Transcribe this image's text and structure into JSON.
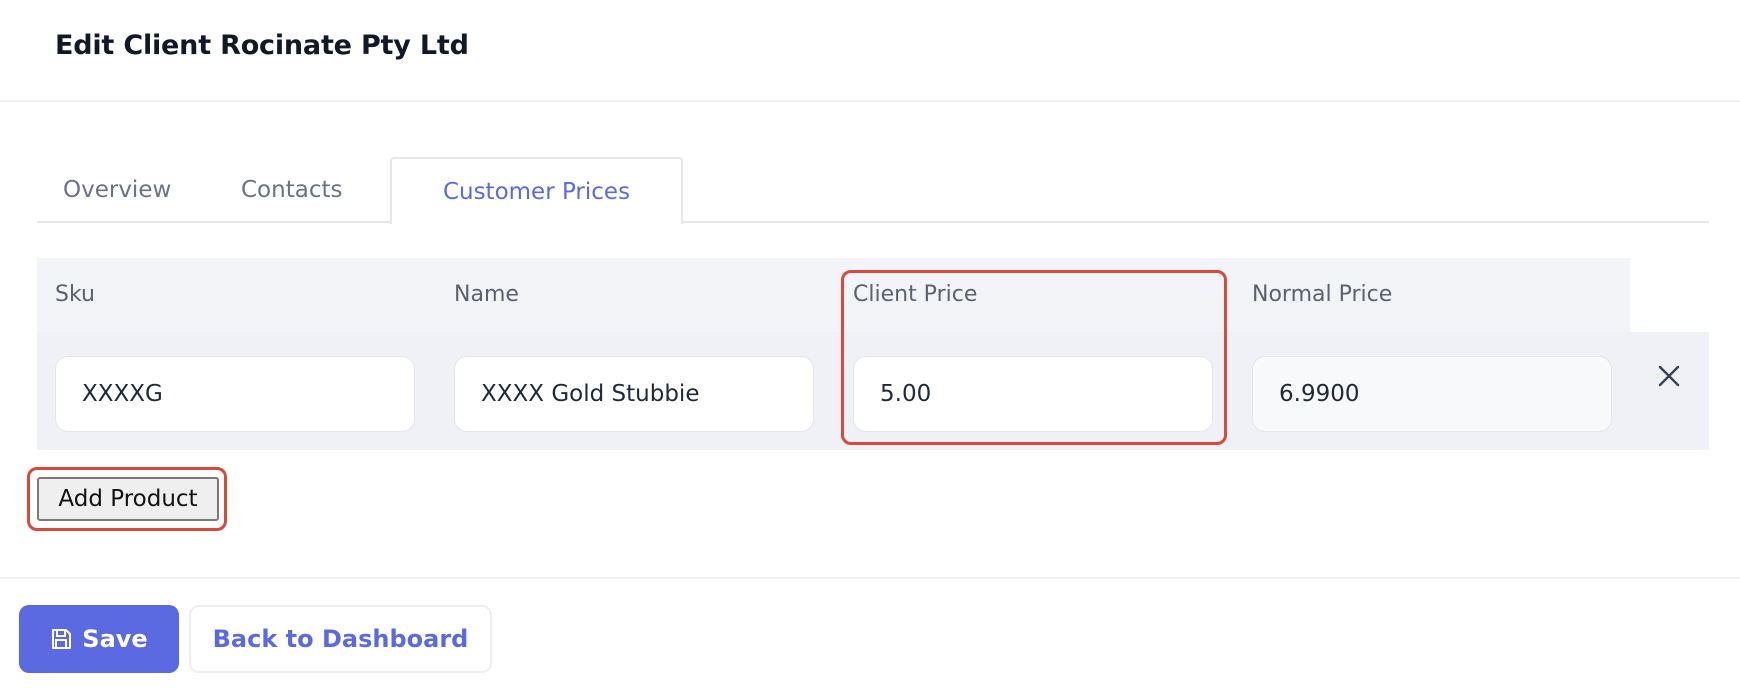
{
  "page": {
    "title": "Edit Client Rocinate Pty Ltd"
  },
  "tabs": [
    {
      "label": "Overview"
    },
    {
      "label": "Contacts"
    },
    {
      "label": "Customer Prices"
    }
  ],
  "active_tab": "Customer Prices",
  "table": {
    "columns": [
      "Sku",
      "Name",
      "Client Price",
      "Normal Price"
    ],
    "rows": [
      {
        "sku": "XXXXG",
        "name": "XXXX Gold Stubbie",
        "client_price": "5.00",
        "normal_price": "6.9900"
      }
    ]
  },
  "actions": {
    "add_product": "Add Product",
    "save": "Save",
    "back": "Back to Dashboard"
  },
  "icons": {
    "remove": "close-icon",
    "save": "floppy-disk-icon"
  },
  "colors": {
    "accent": "#5b6ae0",
    "highlight": "#d64b3c"
  }
}
